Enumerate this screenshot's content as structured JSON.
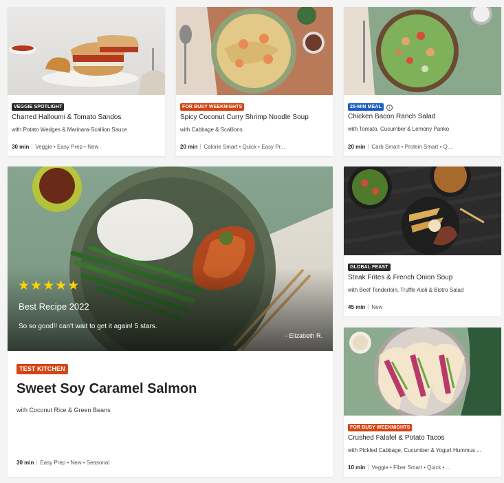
{
  "colors": {
    "badge_dark": "#2b2b2b",
    "badge_orange": "#d64514",
    "badge_blue": "#1d5fc4",
    "star": "#ffd400"
  },
  "cards": [
    {
      "badge": "VEGGIE SPOTLIGHT",
      "badge_color": "#2b2b2b",
      "title": "Charred Halloumi & Tomato Sandos",
      "subtitle": "with Potato Wedges & Marinara-Scallion Sauce",
      "time": "30 min",
      "tags": "Veggie • Easy Prep • New"
    },
    {
      "badge": "FOR BUSY WEEKNIGHTS",
      "badge_color": "#d64514",
      "title": "Spicy Coconut Curry Shrimp Noodle Soup",
      "subtitle": "with Cabbage & Scallions",
      "time": "20 min",
      "tags": "Calorie Smart • Quick • Easy Pr..."
    },
    {
      "badge": "20-MIN MEAL",
      "badge_color": "#1d5fc4",
      "title": "Chicken Bacon Ranch Salad",
      "subtitle": "with Tomato, Cucumber & Lemony Panko",
      "time": "20 min",
      "tags": "Carb Smart • Protein Smart • Q..."
    },
    {
      "badge": "GLOBAL FEAST",
      "badge_color": "#2b2b2b",
      "title": "Steak Frites & French Onion Soup",
      "subtitle": "with Beef Tenderloin, Truffle Aioli & Bistro Salad",
      "time": "45 min",
      "tags": "New"
    },
    {
      "badge": "FOR BUSY WEEKNIGHTS",
      "badge_color": "#d64514",
      "title": "Crushed Falafel & Potato Tacos",
      "subtitle": "with Pickled Cabbage, Cucumber & Yogurt Hummus ...",
      "time": "10 min",
      "tags": "Veggie • Fiber Smart • Quick • ..."
    }
  ],
  "hero": {
    "stars": "★★★★★",
    "rating": 5,
    "review_title": "Best Recipe 2022",
    "review_text": "So so good!! can't wait to get it again! 5 stars.",
    "review_author": "- Elizabeth R.",
    "badge": "TEST KITCHEN",
    "title": "Sweet Soy Caramel Salmon",
    "subtitle": "with Coconut Rice & Green Beans",
    "time": "30 min",
    "tags": "Easy Prep • New • Seasonal"
  }
}
